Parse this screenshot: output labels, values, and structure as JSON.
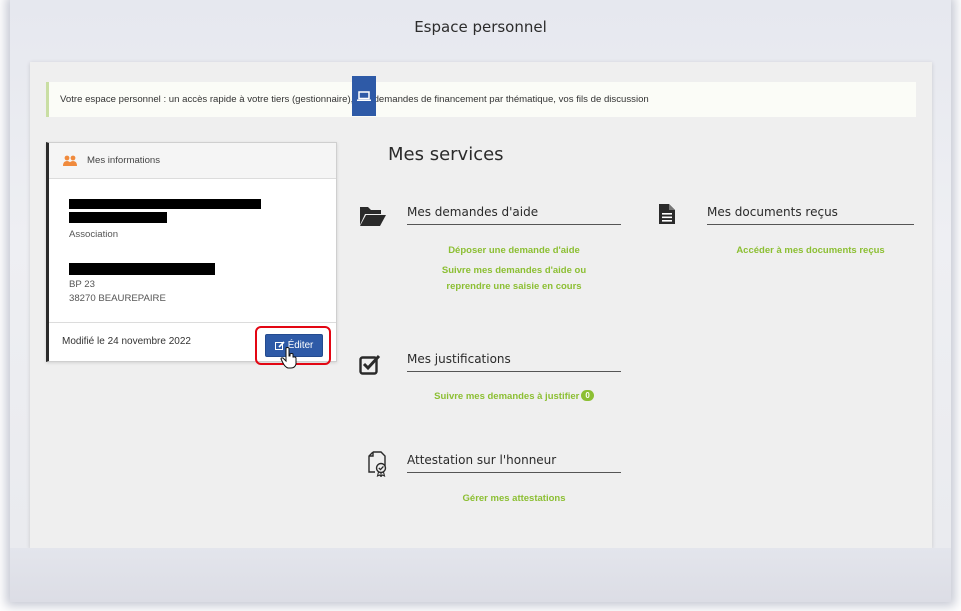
{
  "page": {
    "title": "Espace personnel"
  },
  "banner": {
    "text": "Votre espace personnel : un accès rapide à votre tiers (gestionnaire), vos demandes de financement par thématique, vos fils de discussion"
  },
  "info_card": {
    "title": "Mes informations",
    "type_label": "Association",
    "address_line1": "BP 23",
    "address_line2": "38270 BEAUREPAIRE",
    "modified": "Modifié le 24 novembre 2022",
    "edit_label": "Éditer"
  },
  "services": {
    "title": "Mes services",
    "demandes": {
      "title": "Mes demandes d'aide",
      "link1": "Déposer une demande d'aide",
      "link2_line1": "Suivre mes demandes d'aide ou",
      "link2_line2": "reprendre une saisie en cours"
    },
    "documents": {
      "title": "Mes documents reçus",
      "link1": "Accéder à mes documents reçus"
    },
    "justifications": {
      "title": "Mes justifications",
      "link1": "Suivre mes demandes à justifier",
      "count": "0"
    },
    "attestation": {
      "title": "Attestation sur l'honneur",
      "link1": "Gérer mes attestations"
    }
  },
  "icons": [
    "users-icon",
    "laptop-icon",
    "folder-open-icon",
    "file-text-icon",
    "checkbox-icon",
    "certificate-icon",
    "edit-icon",
    "hand-pointer-icon"
  ],
  "colors": {
    "accent_blue": "#2e5aa7",
    "link_green": "#8cbf33",
    "highlight_red": "#e30613"
  }
}
